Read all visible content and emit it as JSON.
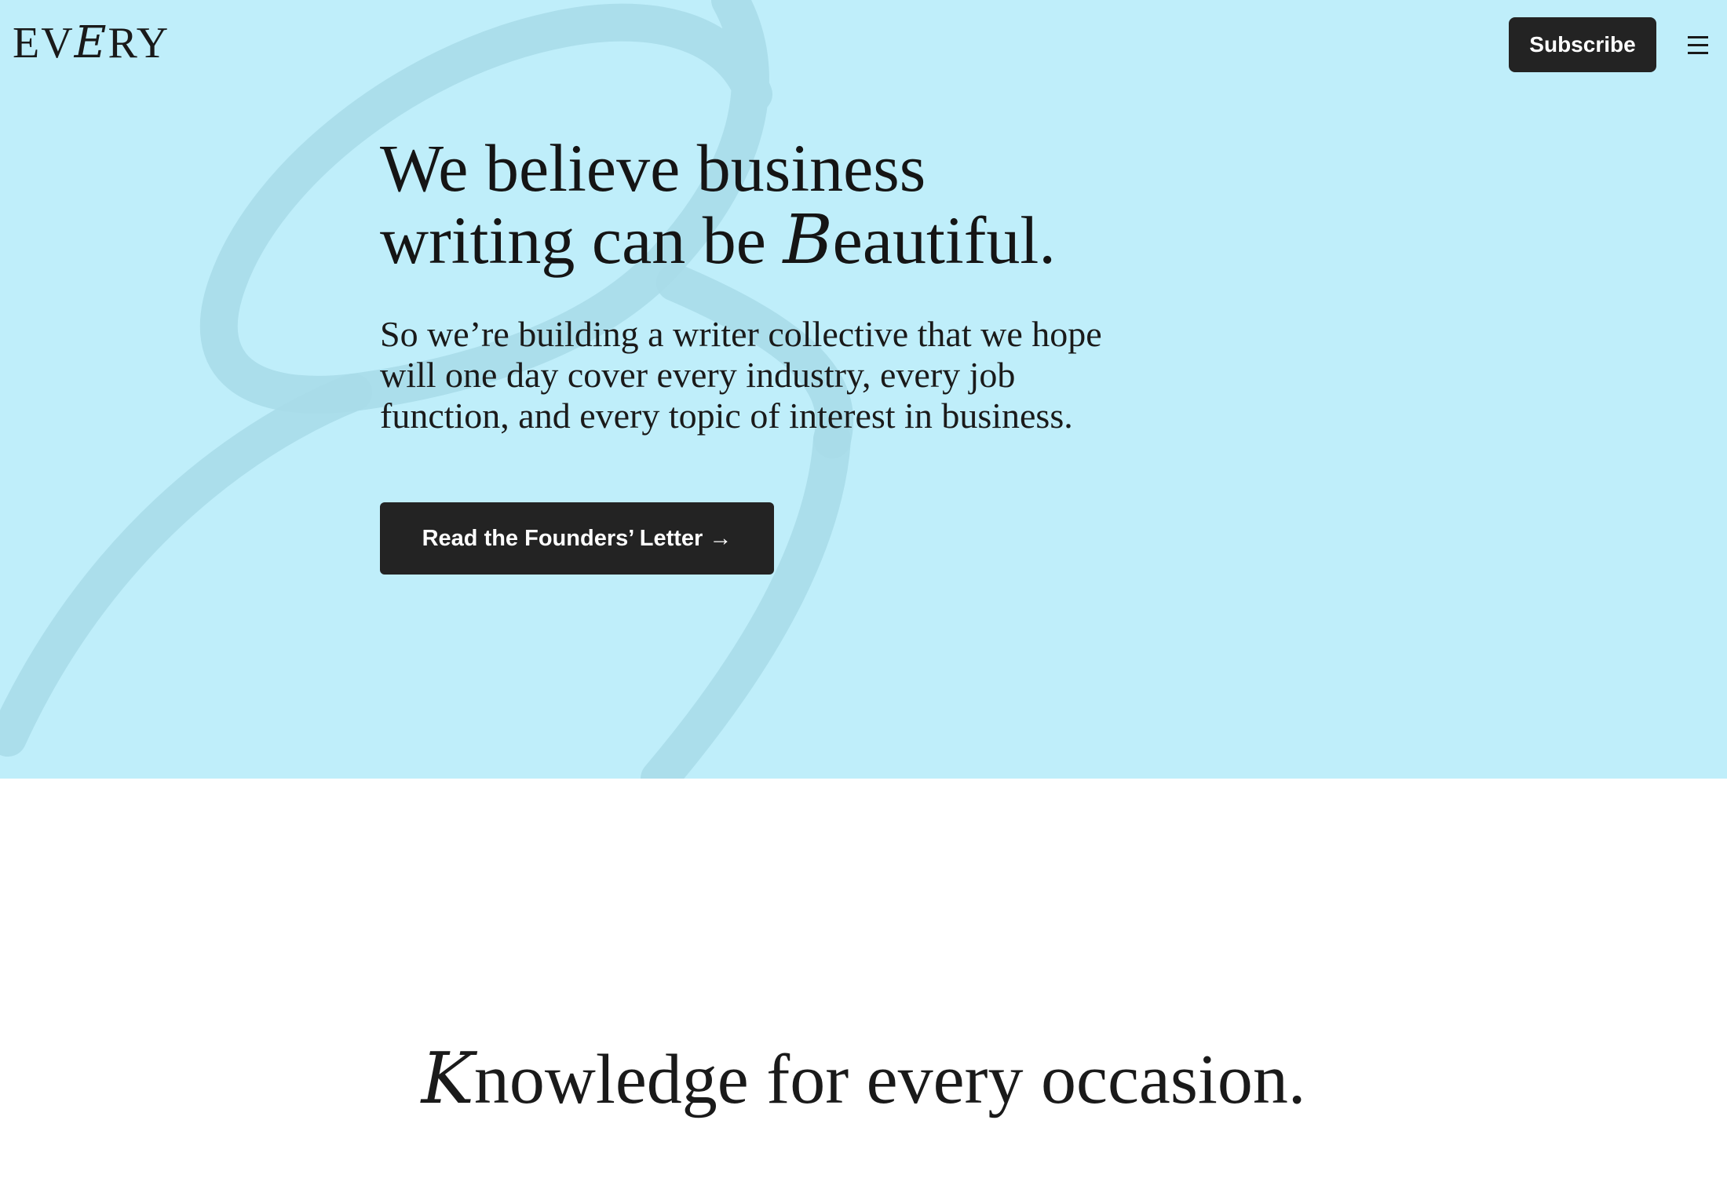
{
  "brand": {
    "logo_prefix": "EV",
    "logo_script": "E",
    "logo_suffix": "RY"
  },
  "header": {
    "subscribe_label": "Subscribe",
    "menu_icon": "hamburger-menu-icon"
  },
  "hero": {
    "title_line1": "We believe business",
    "title_line2_start": "writing can be ",
    "title_script_letter": "B",
    "title_line2_end": "eautiful.",
    "subtitle": "So we’re building a writer collective that we hope will one day cover every industry, every job function, and every topic of interest in business.",
    "cta_label": "Read the Founders’ Letter →"
  },
  "section": {
    "script_letter": "K",
    "title_rest": "nowledge for every occasion."
  },
  "colors": {
    "hero_background": "#bfeefa",
    "squiggle": "#a9dce9",
    "button_background": "#232323",
    "button_text": "#ffffff",
    "text": "#1a1a1a"
  }
}
